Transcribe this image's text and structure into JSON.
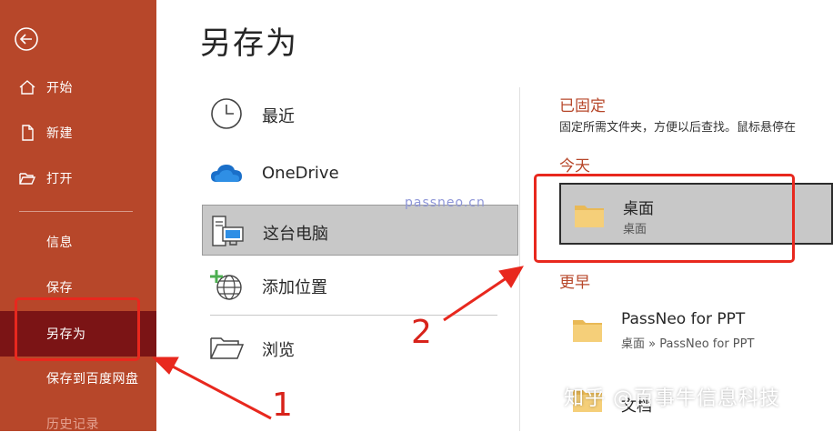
{
  "sidebar": {
    "items": [
      {
        "label": "开始"
      },
      {
        "label": "新建"
      },
      {
        "label": "打开"
      },
      {
        "label": "信息"
      },
      {
        "label": "保存"
      },
      {
        "label": "另存为"
      },
      {
        "label": "保存到百度网盘"
      },
      {
        "label": "历史记录"
      }
    ]
  },
  "page": {
    "title": "另存为"
  },
  "locations": {
    "items": [
      {
        "label": "最近"
      },
      {
        "label": "OneDrive"
      },
      {
        "label": "这台电脑"
      },
      {
        "label": "添加位置"
      },
      {
        "label": "浏览"
      }
    ]
  },
  "watermark": "passneo.cn",
  "right": {
    "pinned_header": "已固定",
    "pinned_desc": "固定所需文件夹，方便以后查找。鼠标悬停在",
    "today_header": "今天",
    "today_folder": {
      "name": "桌面",
      "path": "桌面"
    },
    "earlier_header": "更早",
    "earlier_folder": {
      "name": "PassNeo for PPT",
      "path": "桌面 » PassNeo for PPT"
    },
    "partial_folder_name": "文档"
  },
  "annotations": {
    "one": "1",
    "two": "2"
  },
  "credit": "知乎 @百事牛信息科技",
  "colors": {
    "sidebar": "#b7472a",
    "sidebar_active": "#7b1415",
    "accent_red": "#e8281e",
    "folder": "#f5cf79"
  }
}
